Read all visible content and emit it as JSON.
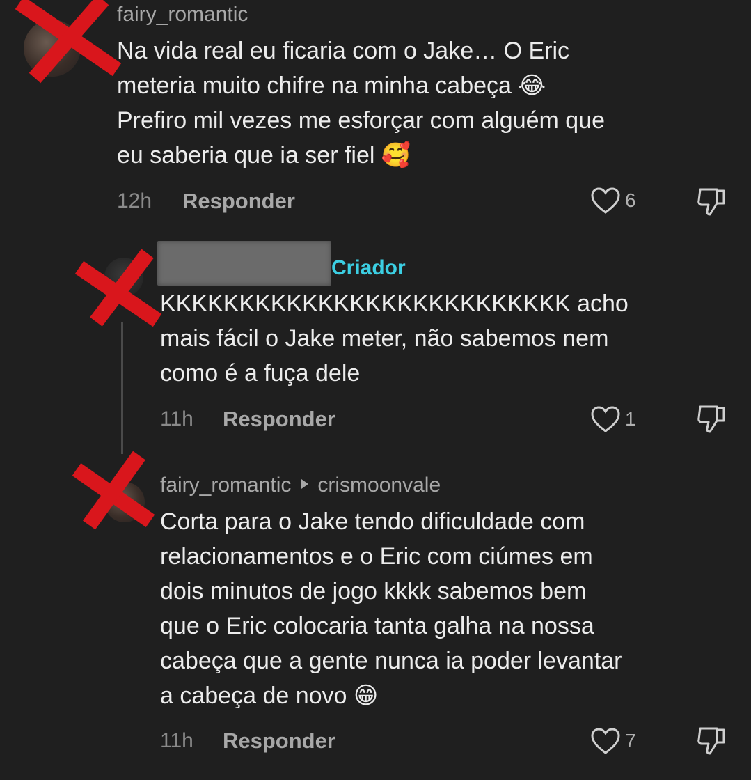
{
  "comments": [
    {
      "username": "fairy_romantic",
      "text": "Na vida real eu ficaria com o Jake… O Eric\nmeteria muito chifre na minha cabeça ",
      "emoji1": "😂",
      "text2": "\nPrefiro mil vezes me esforçar com alguém que\neu saberia que ia ser fiel ",
      "emoji2": "🥰",
      "time": "12h",
      "reply_label": "Responder",
      "likes": "6"
    },
    {
      "creator_label": "Criador",
      "text": "KKKKKKKKKKKKKKKKKKKKKKKKKK acho\nmais fácil o Jake meter, não sabemos nem\ncomo é a fuça dele",
      "time": "11h",
      "reply_label": "Responder",
      "likes": "1"
    },
    {
      "username": "fairy_romantic",
      "reply_to": "crismoonvale",
      "text": "Corta para o Jake tendo dificuldade com\nrelacionamentos e o Eric com ciúmes em\ndois minutos de jogo kkkk sabemos bem\nque o Eric colocaria tanta galha na nossa\ncabeça que a gente nunca ia poder levantar\na cabeça de novo ",
      "emoji1": "😁",
      "time": "11h",
      "reply_label": "Responder",
      "likes": "7"
    }
  ],
  "colors": {
    "background": "#1f1f1f",
    "creator": "#3ccfe3",
    "x_mark": "#d9161c"
  },
  "icons": [
    "heart-icon",
    "dislike-icon",
    "play-arrow-icon",
    "x-mark-icon"
  ]
}
